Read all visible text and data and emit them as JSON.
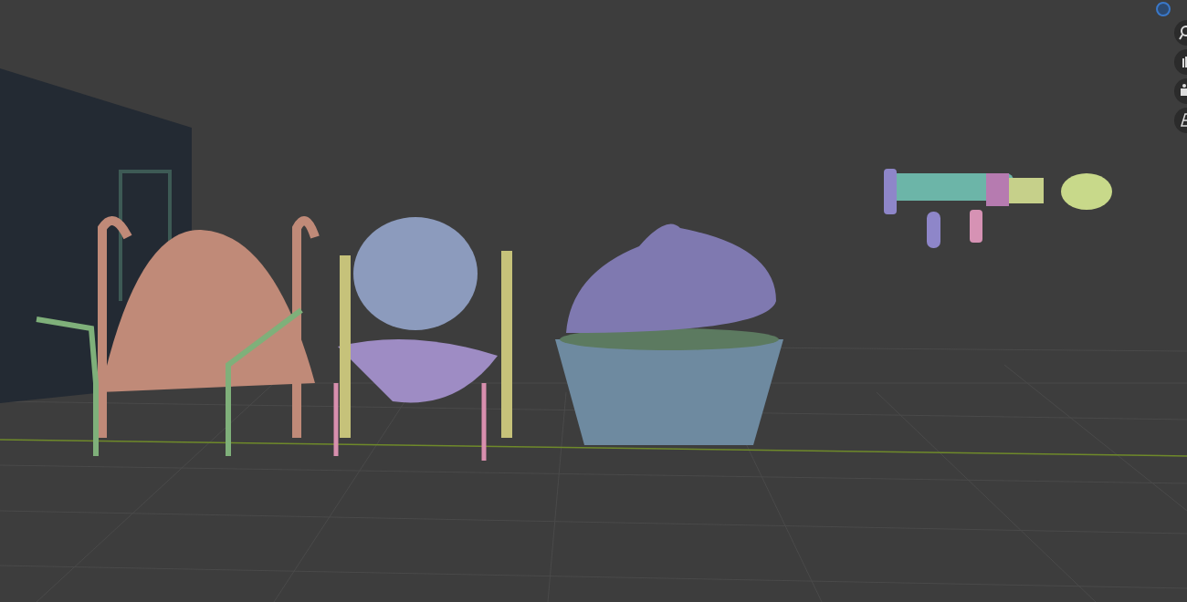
{
  "navigation_buttons": [
    {
      "kind": "zoom"
    },
    {
      "kind": "pan"
    },
    {
      "kind": "camera"
    },
    {
      "kind": "perspective"
    }
  ]
}
